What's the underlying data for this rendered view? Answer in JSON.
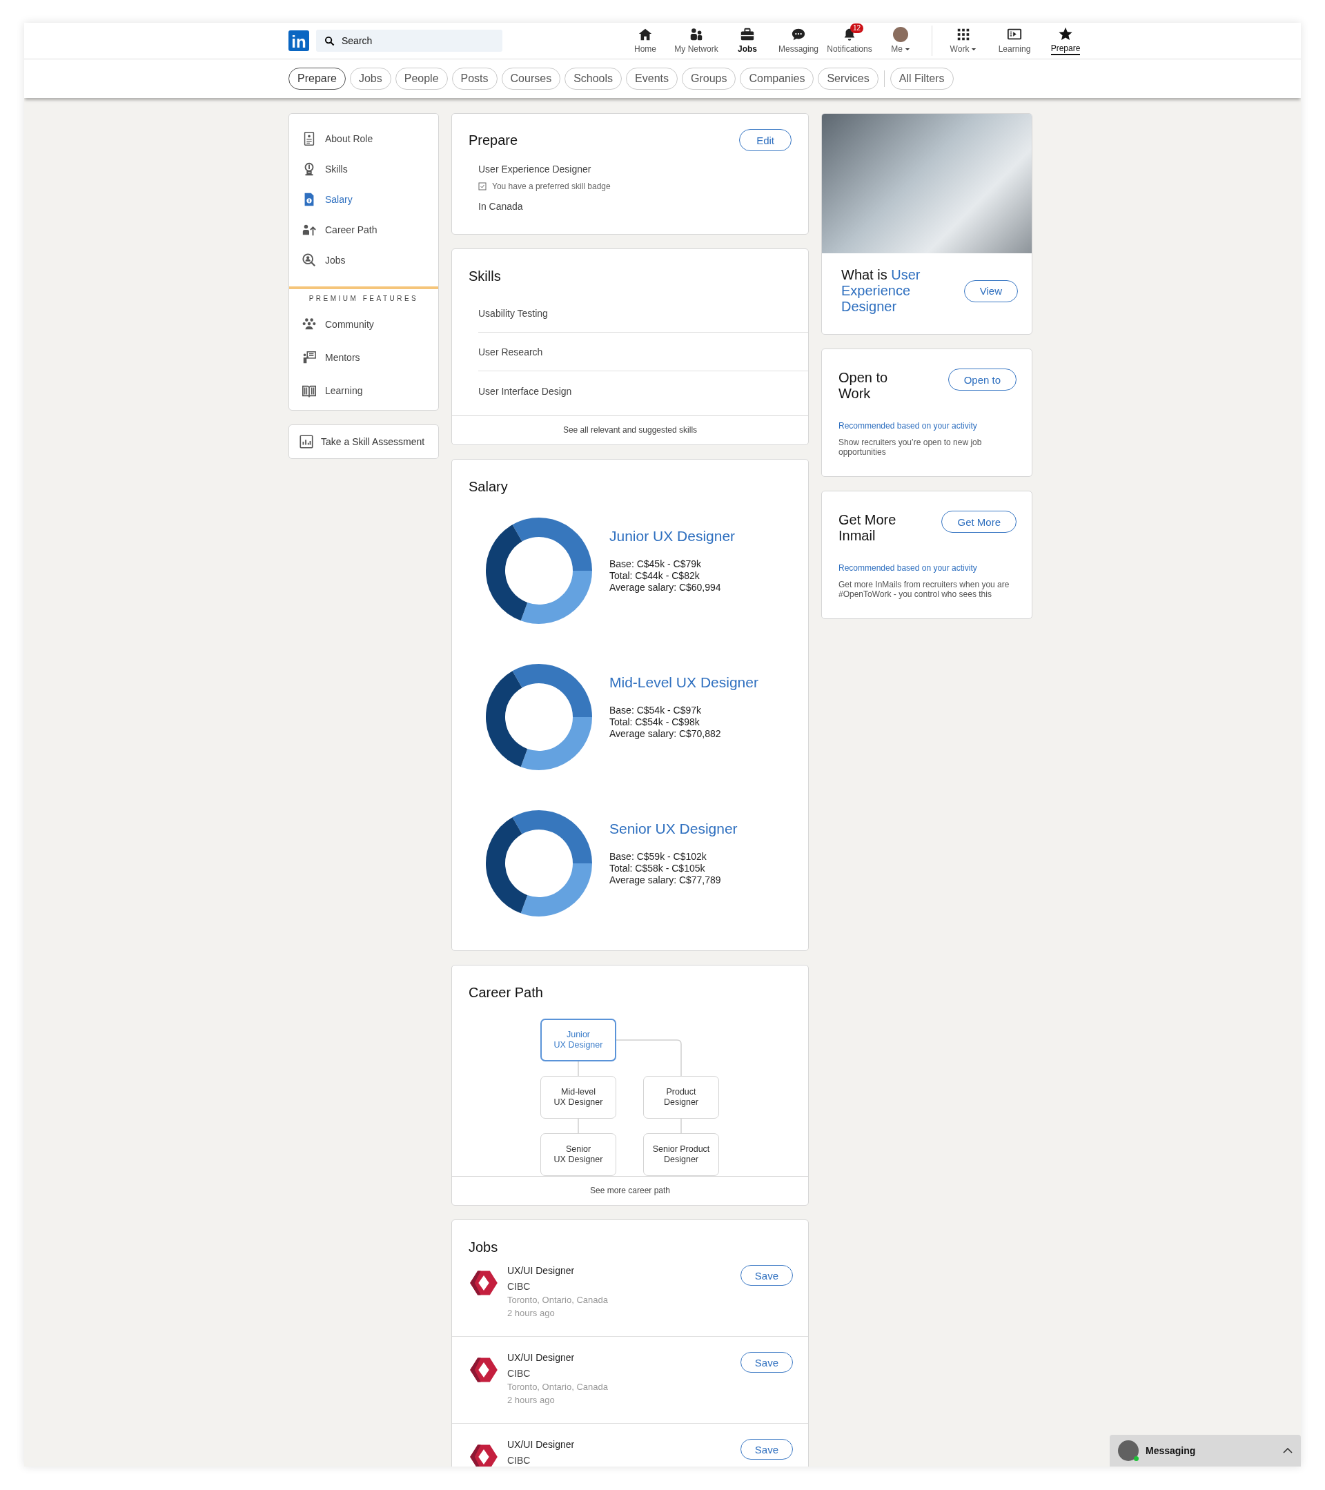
{
  "nav": {
    "logo": "in",
    "search": {
      "placeholder": "Search"
    },
    "items": [
      {
        "kind": "home",
        "label": "Home",
        "bold": false,
        "selected": false
      },
      {
        "kind": "network",
        "label": "My Network",
        "bold": false,
        "selected": false
      },
      {
        "kind": "jobs",
        "label": "Jobs",
        "bold": true,
        "selected": false
      },
      {
        "kind": "messaging",
        "label": "Messaging",
        "bold": false,
        "selected": false
      },
      {
        "kind": "notifications",
        "label": "Notifications",
        "badge": "12",
        "bold": false,
        "selected": false
      },
      {
        "kind": "me",
        "label": "Me",
        "dropdown": true,
        "bold": false,
        "selected": false
      },
      {
        "kind": "work",
        "label": "Work",
        "dropdown": true,
        "bold": false,
        "selected": false
      },
      {
        "kind": "learning",
        "label": "Learning",
        "bold": false,
        "selected": false
      },
      {
        "kind": "prepare",
        "label": "Prepare",
        "bold": false,
        "selected": true
      }
    ]
  },
  "filters": [
    {
      "label": "Prepare",
      "selected": true
    },
    {
      "label": "Jobs",
      "selected": false
    },
    {
      "label": "People",
      "selected": false
    },
    {
      "label": "Posts",
      "selected": false
    },
    {
      "label": "Courses",
      "selected": false
    },
    {
      "label": "Schools",
      "selected": false
    },
    {
      "label": "Events",
      "selected": false
    },
    {
      "label": "Groups",
      "selected": false
    },
    {
      "label": "Companies",
      "selected": false
    },
    {
      "label": "Services",
      "selected": false
    }
  ],
  "all_filters": "All Filters",
  "sidebar": {
    "items": [
      {
        "kind": "about",
        "label": "About Role",
        "selected": false
      },
      {
        "kind": "skills",
        "label": "Skills",
        "selected": false
      },
      {
        "kind": "salary",
        "label": "Salary",
        "selected": true
      },
      {
        "kind": "career",
        "label": "Career Path",
        "selected": false
      },
      {
        "kind": "jobs",
        "label": "Jobs",
        "selected": false
      }
    ],
    "premium_heading": "PREMIUM FEATURES",
    "premium_items": [
      {
        "kind": "community",
        "label": "Community",
        "selected": false
      },
      {
        "kind": "mentors",
        "label": "Mentors",
        "selected": false
      },
      {
        "kind": "learning",
        "label": "Learning",
        "selected": false
      }
    ],
    "assessment": "Take a Skill Assessment"
  },
  "prepare": {
    "title": "Prepare",
    "button": "Edit",
    "role": "User Experience Designer",
    "badge_note": "You have a preferred skill badge",
    "location": "In Canada"
  },
  "skills": {
    "title": "Skills",
    "items": [
      "Usability Testing",
      "User Research",
      "User Interface Design"
    ],
    "link": "See all relevant and suggested skills"
  },
  "salary": {
    "title": "Salary",
    "levels": [
      {
        "title": "Junior UX Designer",
        "lines": [
          "Base: C$45k - C$79k",
          "Total: C$44k - C$82k",
          "Average salary: C$60,994"
        ]
      },
      {
        "title": "Mid-Level UX Designer",
        "lines": [
          "Base: C$54k - C$97k",
          "Total: C$54k - C$98k",
          "Average salary: C$70,882"
        ]
      },
      {
        "title": "Senior UX Designer",
        "lines": [
          "Base: C$59k - C$102k",
          "Total: C$58k - C$105k",
          "Average salary: C$77,789"
        ]
      }
    ]
  },
  "career_path": {
    "title": "Career Path",
    "tree": {
      "lines": [
        "Junior",
        "UX Designer"
      ],
      "selected": true,
      "children": [
        {
          "lines": [
            "Mid-level",
            "UX Designer"
          ],
          "selected": false,
          "children": [
            {
              "lines": [
                "Senior",
                "UX Designer"
              ],
              "selected": false
            }
          ]
        },
        {
          "lines": [
            "Product",
            "Designer"
          ],
          "selected": false,
          "children": [
            {
              "lines": [
                "Senior Product",
                "Designer"
              ],
              "selected": false
            }
          ]
        }
      ]
    },
    "link": "See more career path"
  },
  "jobs": {
    "title": "Jobs",
    "items": [
      {
        "title": "UX/UI Designer",
        "company": "CIBC",
        "location": "Toronto, Ontario, Canada",
        "time": "2 hours ago",
        "button": "Save"
      },
      {
        "title": "UX/UI Designer",
        "company": "CIBC",
        "location": "Toronto, Ontario, Canada",
        "time": "2 hours ago",
        "button": "Save"
      },
      {
        "title": "UX/UI Designer",
        "company": "CIBC",
        "button": "Save"
      }
    ]
  },
  "promo": {
    "title_prefix": "What is",
    "title_highlight": "User Experience Designer",
    "button": "View"
  },
  "cards": [
    {
      "title": "Open to Work",
      "button": "Open to",
      "note": "Recommended based on your activity",
      "text": "Show recruiters you’re open to new job opportunities"
    },
    {
      "title": "Get More Inmail",
      "button": "Get More",
      "note": "Recommended based on your activity",
      "text": "Get more InMails from recruiters when you are #OpenToWork -  you control who sees this"
    }
  ],
  "messaging": {
    "label": "Messaging",
    "online": true
  }
}
